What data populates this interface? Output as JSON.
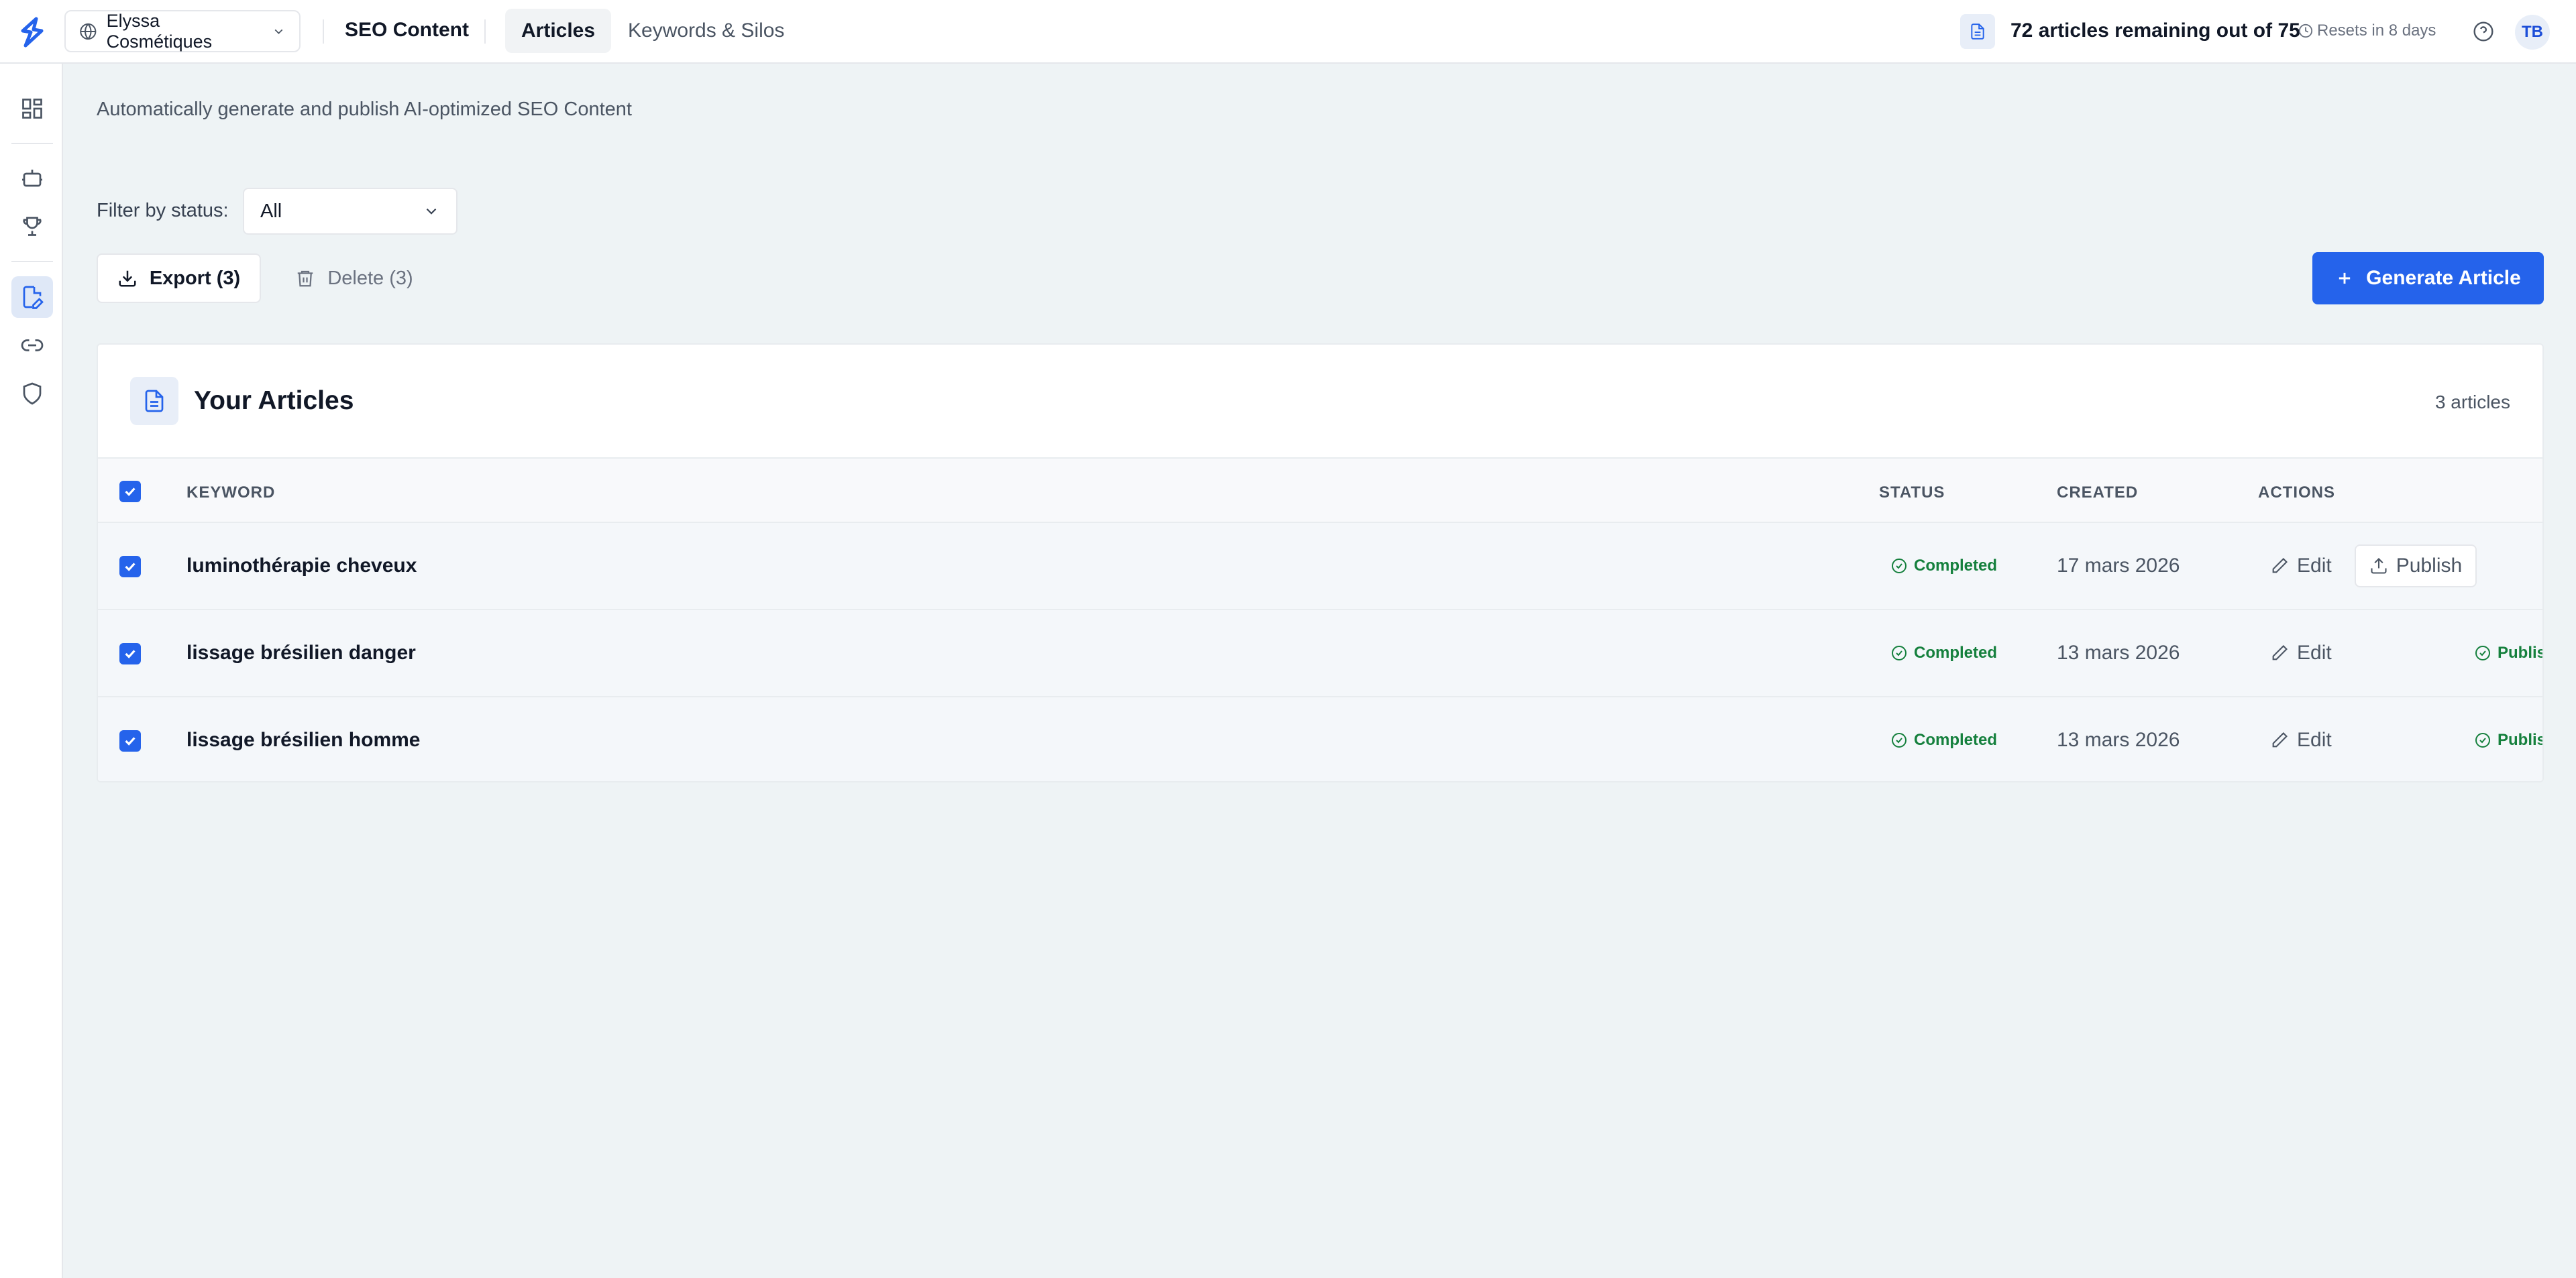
{
  "header": {
    "site_name": "Elyssa Cosmétiques",
    "app_title": "SEO Content",
    "tabs": [
      {
        "label": "Articles",
        "active": true
      },
      {
        "label": "Keywords & Silos",
        "active": false
      }
    ],
    "quota_text": "72 articles remaining out of 75",
    "reset_text": "Resets in 8 days",
    "avatar_initials": "TB"
  },
  "sidebar": {
    "items": [
      {
        "icon": "dashboard-icon",
        "active": false
      },
      {
        "icon": "robot-icon",
        "active": false
      },
      {
        "icon": "trophy-icon",
        "active": false
      },
      {
        "icon": "article-edit-icon",
        "active": true
      },
      {
        "icon": "link-icon",
        "active": false
      },
      {
        "icon": "shield-icon",
        "active": false
      }
    ]
  },
  "main": {
    "subtitle": "Automatically generate and publish AI-optimized SEO Content",
    "filter": {
      "label": "Filter by status:",
      "value": "All"
    },
    "export_label": "Export (3)",
    "delete_label": "Delete (3)",
    "generate_label": "Generate Article",
    "card_title": "Your Articles",
    "card_count": "3 articles",
    "columns": {
      "keyword": "KEYWORD",
      "status": "STATUS",
      "created": "CREATED",
      "actions": "ACTIONS"
    },
    "rows": [
      {
        "keyword": "luminothérapie cheveux",
        "status": "Completed",
        "created": "17 mars 2026",
        "edit": "Edit",
        "publish": "Publish",
        "published": null
      },
      {
        "keyword": "lissage brésilien danger",
        "status": "Completed",
        "created": "13 mars 2026",
        "edit": "Edit",
        "publish": null,
        "published": "Published"
      },
      {
        "keyword": "lissage brésilien homme",
        "status": "Completed",
        "created": "13 mars 2026",
        "edit": "Edit",
        "publish": null,
        "published": "Published"
      }
    ]
  },
  "colors": {
    "accent": "#2563eb",
    "success": "#15803d",
    "background": "#eef3f5"
  }
}
